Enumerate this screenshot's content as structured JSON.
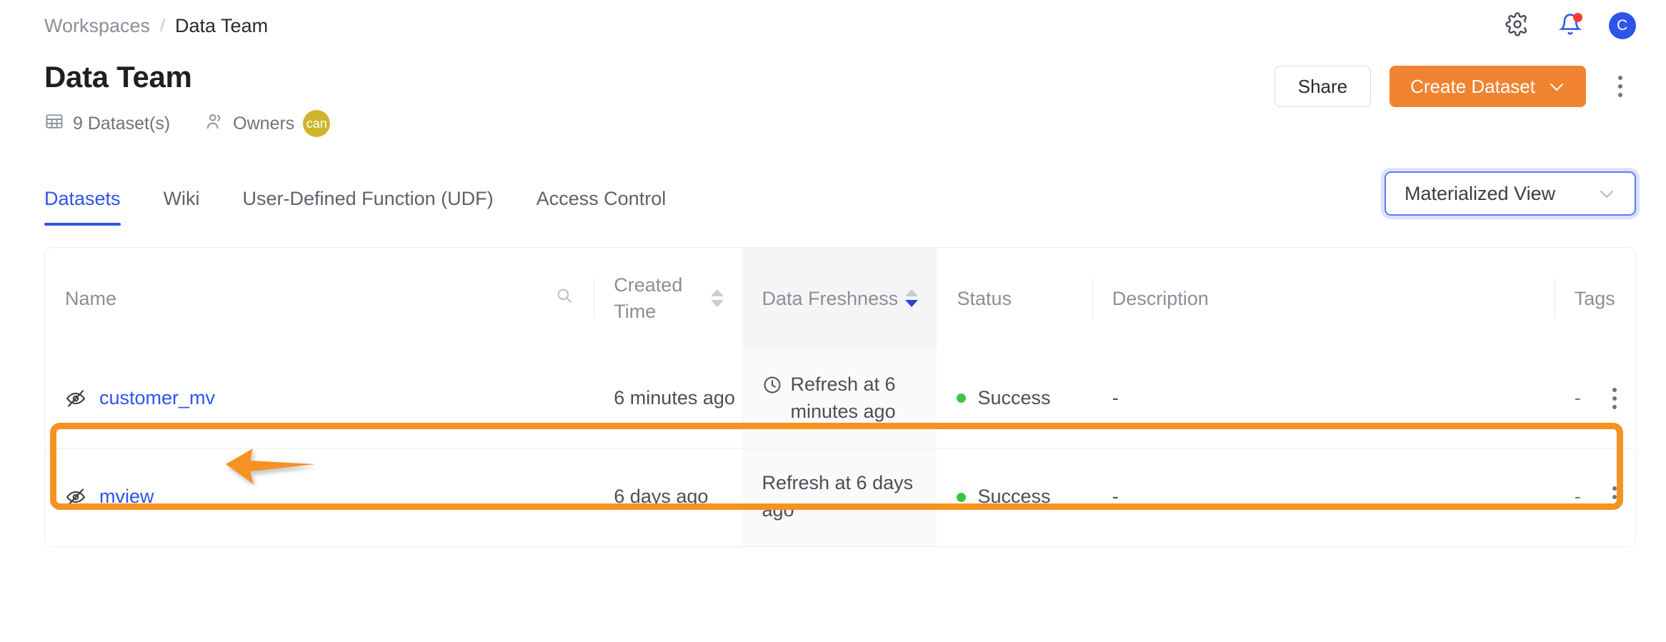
{
  "topbar": {
    "breadcrumb": {
      "parent": "Workspaces",
      "separator": "/",
      "current": "Data Team"
    },
    "icons": {
      "settings": "gear-icon",
      "notifications": "bell-icon",
      "avatar_initial": "C"
    }
  },
  "header": {
    "title": "Data Team",
    "dataset_count": "9 Dataset(s)",
    "owners_label": "Owners",
    "owner_avatar": "can",
    "share_label": "Share",
    "create_label": "Create Dataset",
    "create_caret": "⌄"
  },
  "tabs": [
    {
      "label": "Datasets",
      "active": true
    },
    {
      "label": "Wiki",
      "active": false
    },
    {
      "label": "User-Defined Function (UDF)",
      "active": false
    },
    {
      "label": "Access Control",
      "active": false
    }
  ],
  "view_filter": {
    "value": "Materialized View",
    "caret": "⌄"
  },
  "table": {
    "columns": [
      {
        "label": "Name",
        "sortable": false,
        "searchable": true,
        "sorted": false
      },
      {
        "label": "Created Time",
        "sortable": true,
        "searchable": false,
        "sorted": false
      },
      {
        "label": "Data Freshness",
        "sortable": true,
        "searchable": false,
        "sorted": true,
        "sort_dir": "desc"
      },
      {
        "label": "Status",
        "sortable": false,
        "searchable": false,
        "sorted": false
      },
      {
        "label": "Description",
        "sortable": false,
        "searchable": false,
        "sorted": false
      },
      {
        "label": "Tags",
        "sortable": false,
        "searchable": false,
        "sorted": false
      }
    ],
    "rows": [
      {
        "name": "customer_mv",
        "name_icon": "eye-off-icon",
        "created_time": "6 minutes ago",
        "data_freshness": "Refresh at 6 minutes ago",
        "freshness_icon": "clock-icon",
        "status": "Success",
        "status_color": "#3ec53e",
        "description": "-",
        "tags": "-",
        "highlighted": true
      },
      {
        "name": "mview",
        "name_icon": "eye-off-icon",
        "created_time": "6 days ago",
        "data_freshness": "Refresh at 6 days ago",
        "freshness_icon": "",
        "status": "Success",
        "status_color": "#3ec53e",
        "description": "-",
        "tags": "-",
        "highlighted": false
      }
    ]
  },
  "annotation": {
    "type": "arrow-left",
    "color": "#f59220",
    "target": "customer_mv"
  },
  "colors": {
    "accent_orange": "#f18330",
    "highlight_orange": "#f59220",
    "link_blue": "#2f54eb",
    "success_green": "#3ec53e",
    "owner_avatar": "#cfb52b"
  }
}
